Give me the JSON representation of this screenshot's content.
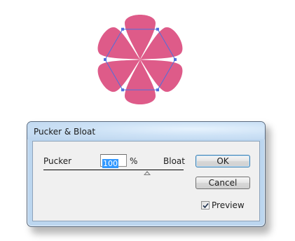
{
  "dialog": {
    "title": "Pucker & Bloat",
    "pucker_label": "Pucker",
    "bloat_label": "Bloat",
    "value": "100",
    "unit": "%",
    "slider_value_percent": 100,
    "ok_label": "OK",
    "cancel_label": "Cancel",
    "preview_label": "Preview",
    "preview_checked": true
  },
  "artwork": {
    "shape": "six-petal flower",
    "fill_color": "#de5b89",
    "selection_color": "#4f6fdc",
    "selected": true
  },
  "colors": {
    "title_bar": "#cde2f6",
    "dialog_frame": "#bcd6ef",
    "client_area": "#f0f0f0",
    "selection_highlight": "#3399ff"
  }
}
